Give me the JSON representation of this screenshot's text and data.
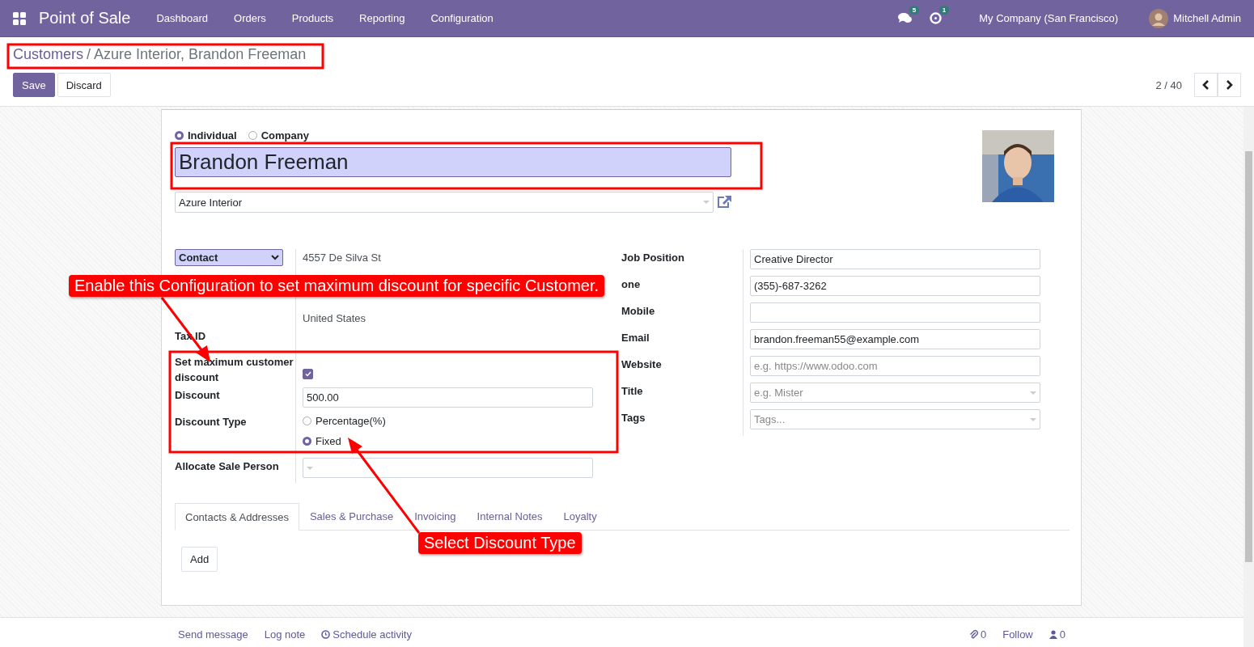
{
  "navbar": {
    "app_title": "Point of Sale",
    "menu": [
      "Dashboard",
      "Orders",
      "Products",
      "Reporting",
      "Configuration"
    ],
    "messages_badge": "5",
    "activities_badge": "1",
    "company": "My Company (San Francisco)",
    "user": "Mitchell Admin"
  },
  "breadcrumb": {
    "parent": "Customers",
    "separator": "/",
    "current": "Azure Interior, Brandon Freeman"
  },
  "buttons": [
    {
      "label": "Save",
      "kind": "primary"
    },
    {
      "label": "Discard",
      "kind": "secondary"
    }
  ],
  "pager": "2 / 40",
  "form": {
    "company_type": [
      {
        "label": "Individual",
        "selected": true
      },
      {
        "label": "Company",
        "selected": false
      }
    ],
    "name": "Brandon Freeman",
    "parent_company": "Azure Interior",
    "address_type": "Contact",
    "address_lines": [
      "4557 De Silva St",
      "United States"
    ],
    "left_fields": [
      {
        "kind": "text",
        "label": "Tax ID"
      },
      {
        "kind": "checkbox",
        "label": "Set maximum customer discount",
        "checked": true
      },
      {
        "kind": "input",
        "label": "Discount",
        "value": "500.00"
      },
      {
        "kind": "radio",
        "label": "Discount Type",
        "options": [
          {
            "label": "Percentage(%)",
            "selected": false
          },
          {
            "label": "Fixed",
            "selected": true
          }
        ]
      },
      {
        "kind": "select",
        "label": "Allocate Sale Person"
      }
    ],
    "right_fields": [
      {
        "kind": "input",
        "label": "Job Position",
        "value": "Creative Director"
      },
      {
        "kind": "input",
        "label": "one",
        "value": "(355)-687-3262"
      },
      {
        "kind": "input",
        "label": "Mobile"
      },
      {
        "kind": "input",
        "label": "Email",
        "value": "brandon.freeman55@example.com"
      },
      {
        "kind": "input",
        "label": "Website",
        "placeholder": "e.g. https://www.odoo.com"
      },
      {
        "kind": "select",
        "label": "Title",
        "placeholder": "e.g. Mister"
      },
      {
        "kind": "select",
        "label": "Tags",
        "placeholder": "Tags..."
      }
    ],
    "tabs": [
      {
        "label": "Contacts & Addresses",
        "selected": true
      },
      {
        "label": "Sales & Purchase",
        "selected": false
      },
      {
        "label": "Invoicing",
        "selected": false
      },
      {
        "label": "Internal Notes",
        "selected": false
      },
      {
        "label": "Loyalty",
        "selected": false
      }
    ],
    "add_button": "Add"
  },
  "chatter": {
    "actions": [
      "Send message",
      "Log note",
      "Schedule activity"
    ],
    "attachments": "0",
    "follow": "Follow",
    "followers": "0"
  },
  "annotations": [
    {
      "text": "Enable this Configuration to set maximum discount for specific Customer."
    },
    {
      "text": "Select Discount Type"
    }
  ]
}
